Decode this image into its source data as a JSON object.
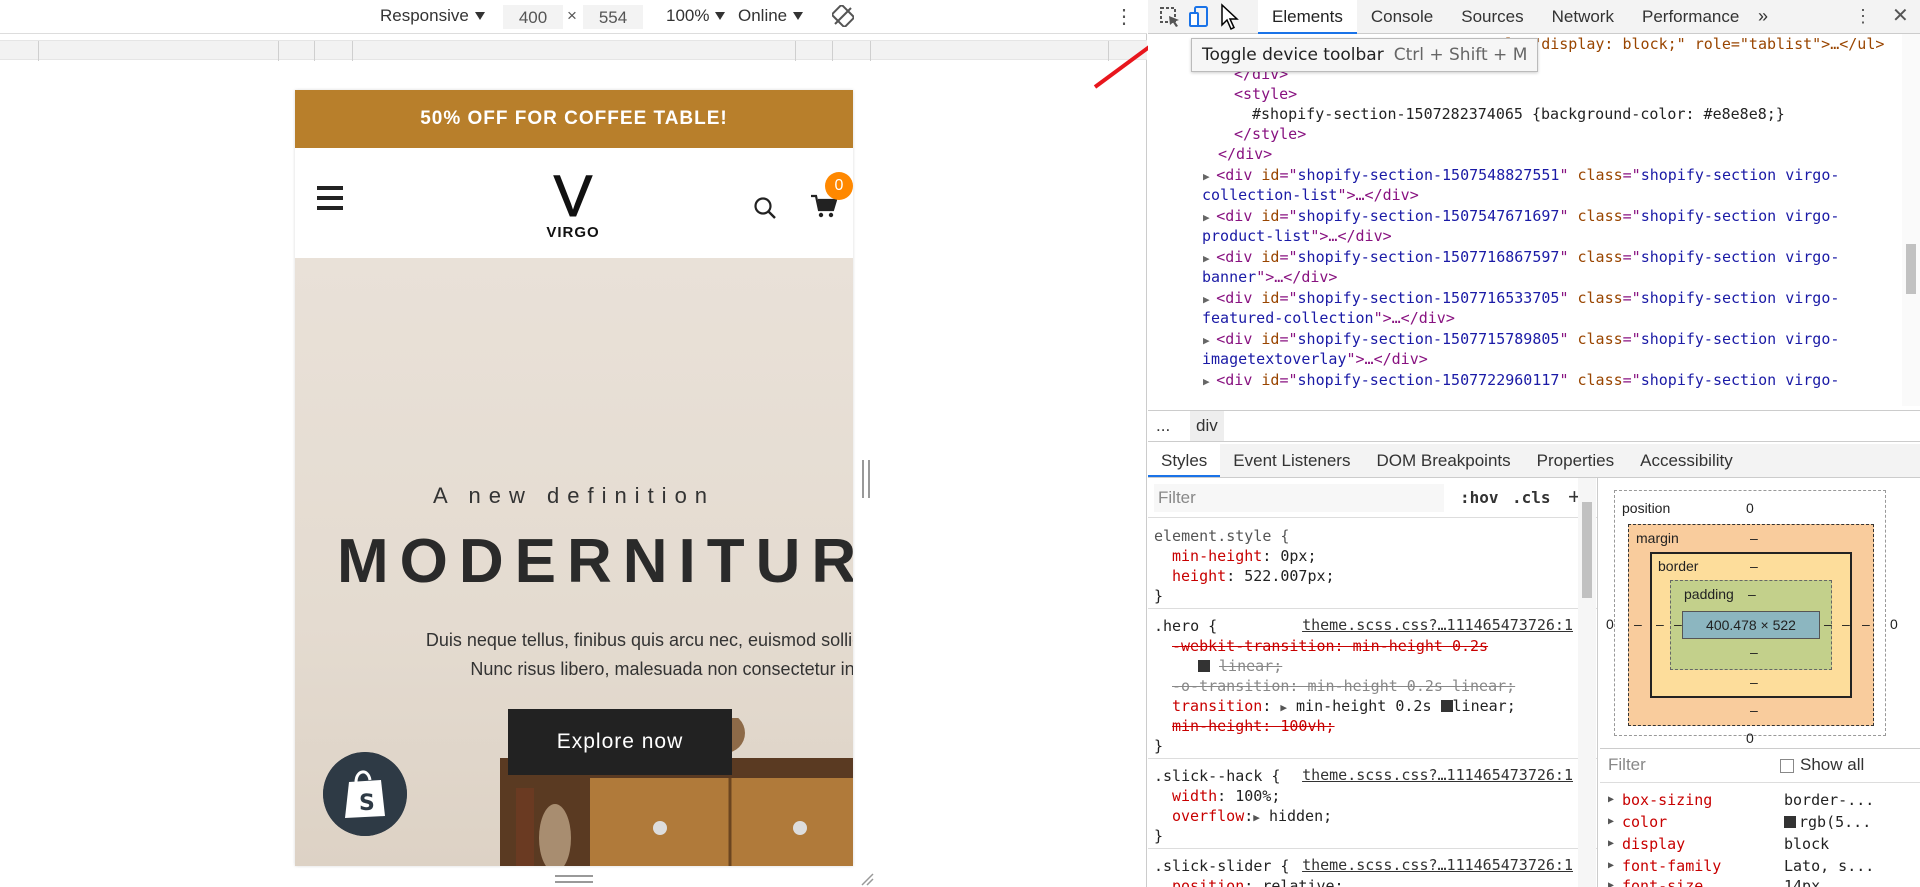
{
  "device_toolbar": {
    "device": "Responsive",
    "width": "400",
    "times": "×",
    "height": "554",
    "zoom": "100%",
    "network": "Online"
  },
  "site": {
    "promo": "50% OFF FOR COFFEE TABLE!",
    "logo_letter": "V",
    "logo_name": "VIRGO",
    "cart_count": "0",
    "hero_tagline": "A new definition",
    "hero_title": "MODERNITURE",
    "hero_desc_line1": "Duis neque tellus, finibus quis arcu nec, euismod sollicitudin",
    "hero_desc_line2": "Nunc risus libero, malesuada non consectetur in.",
    "hero_cta": "Explore now"
  },
  "devtools": {
    "tabs": [
      "Elements",
      "Console",
      "Sources",
      "Network",
      "Performance"
    ],
    "more": "»",
    "tooltip_label": "Toggle device toolbar",
    "tooltip_shortcut": "Ctrl + Shift + M",
    "breadcrumb_dots": "...",
    "breadcrumb_current": "div",
    "subtabs": [
      "Styles",
      "Event Listeners",
      "DOM Breakpoints",
      "Properties",
      "Accessibility"
    ],
    "filter_placeholder": "Filter",
    "hov": ":hov",
    "cls": ".cls",
    "plus": "+"
  },
  "dom_lines": {
    "l0a": "style=\"display: block;\" role=\"tablist\">…</ul>",
    "l1": "</div>",
    "l2": "<style>",
    "l3": "#shopify-section-1507282374065 {background-color: #e8e8e8;}",
    "l4": "</style>",
    "l5": "</div>",
    "s1_id": "shopify-section-1507548827551",
    "s1_cls_a": "shopify-section virgo-",
    "s1_cls_b": "collection-list",
    "s2_id": "shopify-section-1507547671697",
    "s2_cls_a": "shopify-section virgo-",
    "s2_cls_b": "product-list",
    "s3_id": "shopify-section-1507716867597",
    "s3_cls_a": "shopify-section virgo-",
    "s3_cls_b": "banner",
    "s4_id": "shopify-section-1507716533705",
    "s4_cls_a": "shopify-section virgo-",
    "s4_cls_b": "featured-collection",
    "s5_id": "shopify-section-1507715789805",
    "s5_cls_a": "shopify-section virgo-",
    "s5_cls_b": "imagetextoverlay",
    "s6_id": "shopify-section-1507722960117",
    "s6_cls_a": "shopify-section virgo-"
  },
  "styles": {
    "r1_sel": "element.style {",
    "r1_p1": "min-height",
    "r1_v1": "0px;",
    "r1_p2": "height",
    "r1_v2": "522.007px;",
    "close": "}",
    "r2_sel": ".hero {",
    "r2_src": "theme.scss.css?…111465473726:1",
    "r2_l1": "-webkit-transition: min-height 0.2s",
    "r2_l1b": "linear;",
    "r2_l2": "-o-transition: min-height 0.2s linear;",
    "r2_p3": "transition",
    "r2_v3": "min-height 0.2s",
    "r2_v3b": "linear;",
    "r2_l4": "min-height: 100vh;",
    "r3_sel": ".slick--hack {",
    "r3_src": "theme.scss.css?…111465473726:1",
    "r3_p1": "width",
    "r3_v1": "100%;",
    "r3_p2": "overflow",
    "r3_v2": "hidden;",
    "r4_sel": ".slick-slider {",
    "r4_src": "theme.scss.css?…111465473726:1",
    "r4_p1": "position",
    "r4_v1": "relative;"
  },
  "box_model": {
    "position_label": "position",
    "position_val": "0",
    "margin_label": "margin",
    "border_label": "border",
    "padding_label": "padding",
    "dash": "–",
    "zero": "0",
    "content": "400.478 × 522"
  },
  "computed": {
    "filter": "Filter",
    "show_all": "Show all",
    "rows": [
      {
        "name": "box-sizing",
        "value": "border-..."
      },
      {
        "name": "color",
        "value": "rgb(5..."
      },
      {
        "name": "display",
        "value": "block"
      },
      {
        "name": "font-family",
        "value": "Lato, s..."
      },
      {
        "name": "font-size",
        "value": "14px"
      }
    ]
  },
  "colors": {
    "promo_bg": "#b87f2b",
    "accent": "#1a73e8",
    "cart_badge": "#ff8800",
    "arrow": "#e8161d"
  }
}
